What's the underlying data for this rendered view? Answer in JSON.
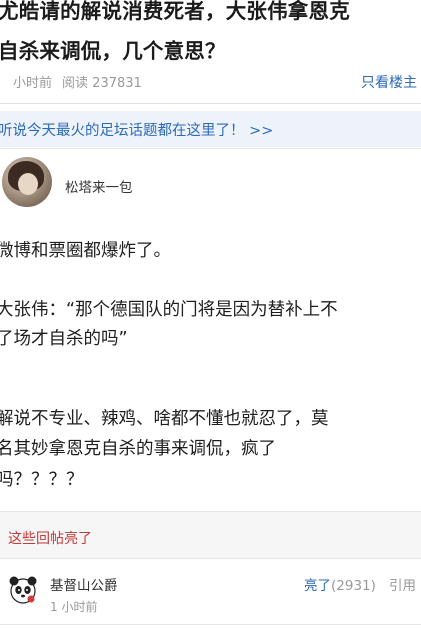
{
  "post": {
    "title_line1": "尤皓请的解说消费死者，大张伟拿恩克",
    "title_line2": "自杀来调侃，几个意思？",
    "time": "小时前",
    "read_label": "阅读",
    "read_count": "237831",
    "only_op_label": "只看楼主"
  },
  "promo": {
    "text": "听说今天最火的足坛话题都在这里了！ >>"
  },
  "author": {
    "name": "松塔来一包"
  },
  "content": {
    "p1": "微博和票圈都爆炸了。",
    "p2_line1": "大张伟：“那个德国队的门将是因为替补上不",
    "p2_line2": "了场才自杀的吗”",
    "p3_line1": "解说不专业、辣鸡、啥都不懂也就忍了，莫",
    "p3_line2": "名其妙拿恩克自杀的事来调侃，疯了",
    "p3_line3": "吗？？？？"
  },
  "hot_replies": {
    "header": "这些回帖亮了"
  },
  "reply": {
    "user": "基督山公爵",
    "time": "1 小时前",
    "like_label": "亮了",
    "like_count": "(2931)",
    "quote_label": "引用"
  },
  "colors": {
    "link_blue": "#2c6ab8",
    "hot_red": "#c23a3a",
    "promo_bg": "#eef3fb",
    "meta_gray": "#9a9a9a"
  },
  "icons": {
    "reply_avatar": "panda-icon"
  }
}
